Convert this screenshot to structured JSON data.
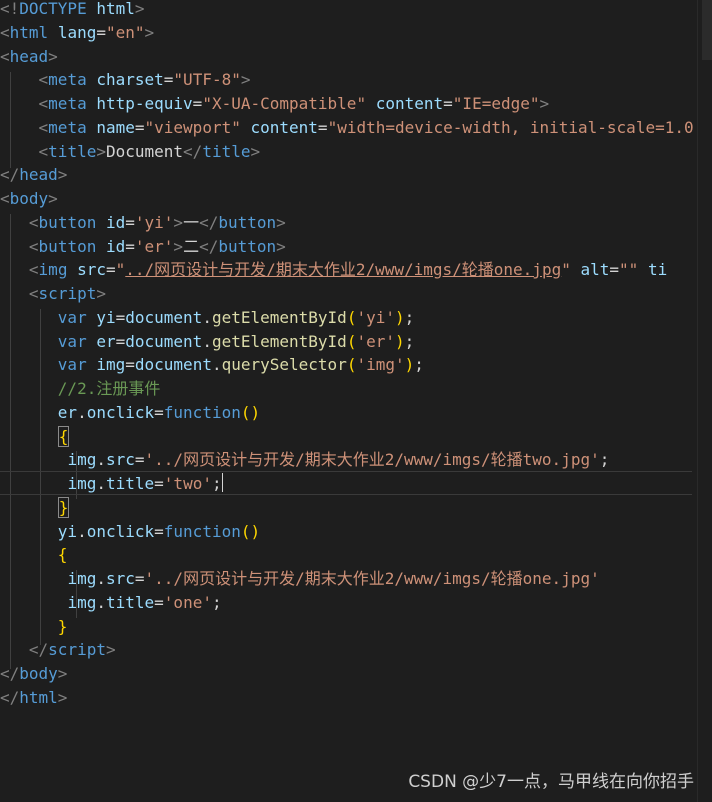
{
  "colors": {
    "background": "#1e1e1e",
    "tag": "#569cd6",
    "attribute": "#9cdcfe",
    "string": "#ce9178",
    "text": "#d4d4d4",
    "function": "#dcdcaa",
    "comment": "#6a9955",
    "bracket": "#ffd700"
  },
  "code": {
    "l1": {
      "b1": "<!",
      "tag": "DOCTYPE",
      "sp": " ",
      "attr": "html",
      "b2": ">"
    },
    "l2": {
      "b1": "<",
      "tag": "html",
      "sp": " ",
      "attr": "lang",
      "eq": "=",
      "val": "\"en\"",
      "b2": ">"
    },
    "l3": {
      "b1": "<",
      "tag": "head",
      "b2": ">"
    },
    "l4": {
      "indent": "    ",
      "b1": "<",
      "tag": "meta",
      "sp": " ",
      "attr": "charset",
      "eq": "=",
      "val": "\"UTF-8\"",
      "b2": ">"
    },
    "l5": {
      "indent": "    ",
      "b1": "<",
      "tag": "meta",
      "sp": " ",
      "attr1": "http-equiv",
      "eq1": "=",
      "val1": "\"X-UA-Compatible\"",
      "sp2": " ",
      "attr2": "content",
      "eq2": "=",
      "val2": "\"IE=edge\"",
      "b2": ">"
    },
    "l6": {
      "indent": "    ",
      "b1": "<",
      "tag": "meta",
      "sp": " ",
      "attr1": "name",
      "eq1": "=",
      "val1": "\"viewport\"",
      "sp2": " ",
      "attr2": "content",
      "eq2": "=",
      "val2": "\"width=device-width, initial-scale=1.0"
    },
    "l7": {
      "indent": "    ",
      "b1": "<",
      "tag": "title",
      "b2": ">",
      "text": "Document",
      "b3": "</",
      "tag2": "title",
      "b4": ">"
    },
    "l8": {
      "b1": "</",
      "tag": "head",
      "b2": ">"
    },
    "l9": {
      "b1": "<",
      "tag": "body",
      "b2": ">"
    },
    "l10": {
      "indent": "   ",
      "b1": "<",
      "tag": "button",
      "sp": " ",
      "attr": "id",
      "eq": "=",
      "val": "'yi'",
      "b2": ">",
      "text": "一",
      "b3": "</",
      "tag2": "button",
      "b4": ">"
    },
    "l11": {
      "indent": "   ",
      "b1": "<",
      "tag": "button",
      "sp": " ",
      "attr": "id",
      "eq": "=",
      "val": "'er'",
      "b2": ">",
      "text": "二",
      "b3": "</",
      "tag2": "button",
      "b4": ">"
    },
    "l12": {
      "indent": "   ",
      "b1": "<",
      "tag": "img",
      "sp": " ",
      "attr1": "src",
      "eq1": "=",
      "q1": "\"",
      "path": "../网页设计与开发/期末大作业2/www/imgs/轮播one.jpg",
      "q2": "\"",
      "sp2": " ",
      "attr2": "alt",
      "eq2": "=",
      "val2": "\"\"",
      "sp3": " ",
      "attr3": "ti"
    },
    "l13": {
      "indent": "   ",
      "b1": "<",
      "tag": "script",
      "b2": ">"
    },
    "l14": {
      "indent": "      ",
      "kw": "var",
      "sp": " ",
      "v": "yi",
      "eq": "=",
      "obj": "document",
      "dot": ".",
      "fn": "getElementById",
      "p1": "(",
      "str": "'yi'",
      "p2": ")",
      "semi": ";"
    },
    "l15": {
      "indent": "      ",
      "kw": "var",
      "sp": " ",
      "v": "er",
      "eq": "=",
      "obj": "document",
      "dot": ".",
      "fn": "getElementById",
      "p1": "(",
      "str": "'er'",
      "p2": ")",
      "semi": ";"
    },
    "l16": {
      "indent": "      ",
      "kw": "var",
      "sp": " ",
      "v": "img",
      "eq": "=",
      "obj": "document",
      "dot": ".",
      "fn": "querySelector",
      "p1": "(",
      "str": "'img'",
      "p2": ")",
      "semi": ";"
    },
    "l17": {
      "indent": "      ",
      "comment": "//2.注册事件"
    },
    "l18": {
      "indent": "      ",
      "v": "er",
      "dot": ".",
      "prop": "onclick",
      "eq": "=",
      "kw": "function",
      "p": "()"
    },
    "l19": {
      "indent": "      ",
      "brace": "{"
    },
    "l20": {
      "indent": "       ",
      "v": "img",
      "dot": ".",
      "prop": "src",
      "eq": "=",
      "str": "'../网页设计与开发/期末大作业2/www/imgs/轮播two.jpg'",
      "semi": ";"
    },
    "l21": {
      "indent": "       ",
      "v": "img",
      "dot": ".",
      "prop": "title",
      "eq": "=",
      "str": "'two'",
      "semi": ";"
    },
    "l22": {
      "indent": "      ",
      "brace": "}"
    },
    "l23": {
      "indent": "      ",
      "v": "yi",
      "dot": ".",
      "prop": "onclick",
      "eq": "=",
      "kw": "function",
      "p": "()"
    },
    "l24": {
      "indent": "      ",
      "brace": "{"
    },
    "l25": {
      "indent": "       ",
      "v": "img",
      "dot": ".",
      "prop": "src",
      "eq": "=",
      "str": "'../网页设计与开发/期末大作业2/www/imgs/轮播one.jpg'"
    },
    "l26": {
      "indent": "       ",
      "v": "img",
      "dot": ".",
      "prop": "title",
      "eq": "=",
      "str": "'one'",
      "semi": ";"
    },
    "l27": {
      "indent": "      ",
      "brace": "}"
    },
    "l28": {
      "indent": "   ",
      "b1": "</",
      "tag": "script",
      "b2": ">"
    },
    "l29": {
      "b1": "</",
      "tag": "body",
      "b2": ">"
    },
    "l30": {
      "b1": "</",
      "tag": "html",
      "b2": ">"
    }
  },
  "watermark": "CSDN @少7一点，马甲线在向你招手"
}
